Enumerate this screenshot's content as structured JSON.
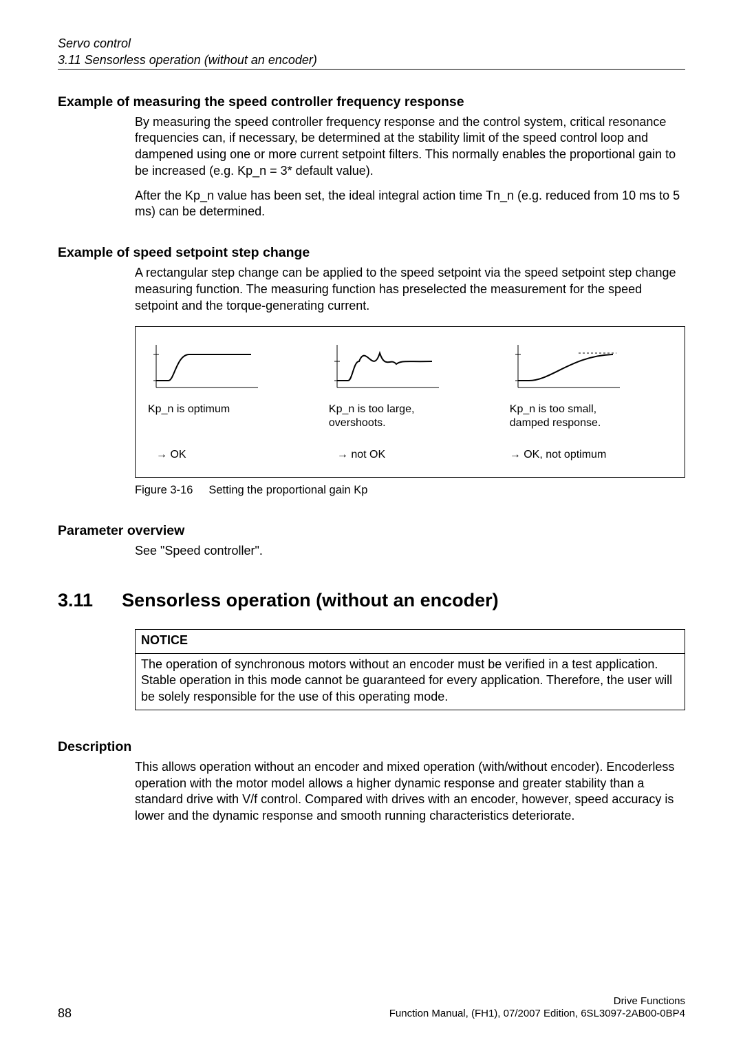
{
  "runningHead": {
    "title": "Servo control",
    "section": "3.11 Sensorless operation (without an encoder)"
  },
  "sec1": {
    "heading": "Example of measuring the speed controller frequency response",
    "p1": "By measuring the speed controller frequency response and the control system, critical resonance frequencies can, if necessary, be determined at the stability limit of the speed control loop and dampened using one or more current setpoint filters. This normally enables the proportional gain to be increased (e.g. Kp_n = 3* default value).",
    "p2": "After the Kp_n value has been set, the ideal integral action time Tn_n (e.g. reduced from 10 ms to 5 ms) can be determined."
  },
  "sec2": {
    "heading": "Example of speed setpoint step change",
    "p1": "A rectangular step change can be applied to the speed setpoint via the speed setpoint step change measuring function. The measuring function has preselected the measurement for the speed setpoint and the torque-generating current."
  },
  "figure": {
    "col1": {
      "label": "Kp_n is optimum",
      "verdict": "→ OK"
    },
    "col2": {
      "label1": "Kp_n is too large,",
      "label2": "overshoots.",
      "verdict": "→ not OK"
    },
    "col3": {
      "label1": "Kp_n is too small,",
      "label2": "damped response.",
      "verdict": "→ OK, not optimum"
    },
    "caption_label": "Figure 3-16",
    "caption_text": "Setting the proportional gain Kp"
  },
  "sec3": {
    "heading": "Parameter overview",
    "p1": "See \"Speed controller\"."
  },
  "h2": {
    "num": "3.11",
    "title": "Sensorless operation (without an encoder)"
  },
  "notice": {
    "title": "NOTICE",
    "body": "The operation of synchronous motors without an encoder must be verified in a test application. Stable operation in this mode cannot be guaranteed for every application. Therefore, the user will be solely responsible for the use of this operating mode."
  },
  "sec4": {
    "heading": "Description",
    "p1": "This allows operation without an encoder and mixed operation (with/without encoder). Encoderless operation with the motor model allows a higher dynamic response and greater stability than a standard drive with V/f control. Compared with drives with an encoder, however, speed accuracy is lower and the dynamic response and smooth running characteristics deteriorate."
  },
  "footer": {
    "page": "88",
    "line1": "Drive Functions",
    "line2": "Function Manual, (FH1), 07/2007 Edition, 6SL3097-2AB00-0BP4"
  }
}
